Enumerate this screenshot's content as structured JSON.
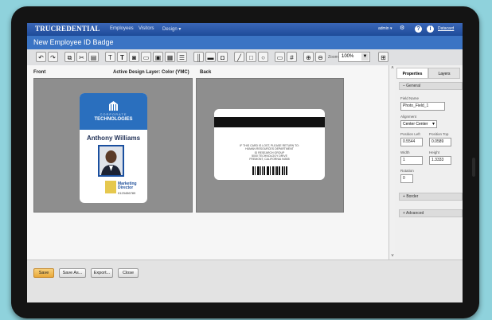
{
  "app": {
    "brand": "TRUCREDENTIAL",
    "nav": [
      "Employees",
      "Visitors",
      "Design ▾"
    ],
    "user": "admin ▾",
    "user_link": "Datacard"
  },
  "window": {
    "title": "New Employee ID Badge"
  },
  "toolbar": {
    "zoom_label": "Zoom",
    "zoom_value": "100%"
  },
  "canvas": {
    "front_label": "Front",
    "layer_label": "Active Design Layer: Color (YMC)",
    "back_label": "Back"
  },
  "front_card": {
    "company_top": "CORPORATE",
    "company_name": "TECHNOLOGIES",
    "employee_name": "Anthony Williams",
    "role_line1": "Marketing",
    "role_line2": "Director",
    "number": "0123456789"
  },
  "back_card": {
    "lines": [
      "IF THIS CARD IS LOST, PLEASE RETURN TO:",
      "HUMAN RESOURCES DEPARTMENT",
      "ID RESEARCH GROUP",
      "5000 TECHNOLOGY DRIVE",
      "FREMONT, CALIFORNIA 94555"
    ]
  },
  "properties": {
    "tabs": [
      "Properties",
      "Layers"
    ],
    "general_title": "General",
    "field_name_label": "Field Name",
    "field_name_value": "Photo_Field_1",
    "alignment_label": "Alignment",
    "alignment_value": "Center Center",
    "pos_left_label": "Position Left",
    "pos_left_value": "0.5544",
    "pos_top_label": "Position Top",
    "pos_top_value": "0.0589",
    "width_label": "Width",
    "width_value": "1",
    "height_label": "Height",
    "height_value": "1.3333",
    "rotation_label": "Rotation",
    "rotation_value": "0",
    "border_title": "Border",
    "advanced_title": "Advanced"
  },
  "buttons": {
    "save": "Save",
    "save_as": "Save As...",
    "export": "Export...",
    "close": "Close"
  },
  "colors": {
    "brand_blue": "#1e4b99",
    "title_blue": "#3b74c4",
    "save_orange": "#e9a83a"
  }
}
